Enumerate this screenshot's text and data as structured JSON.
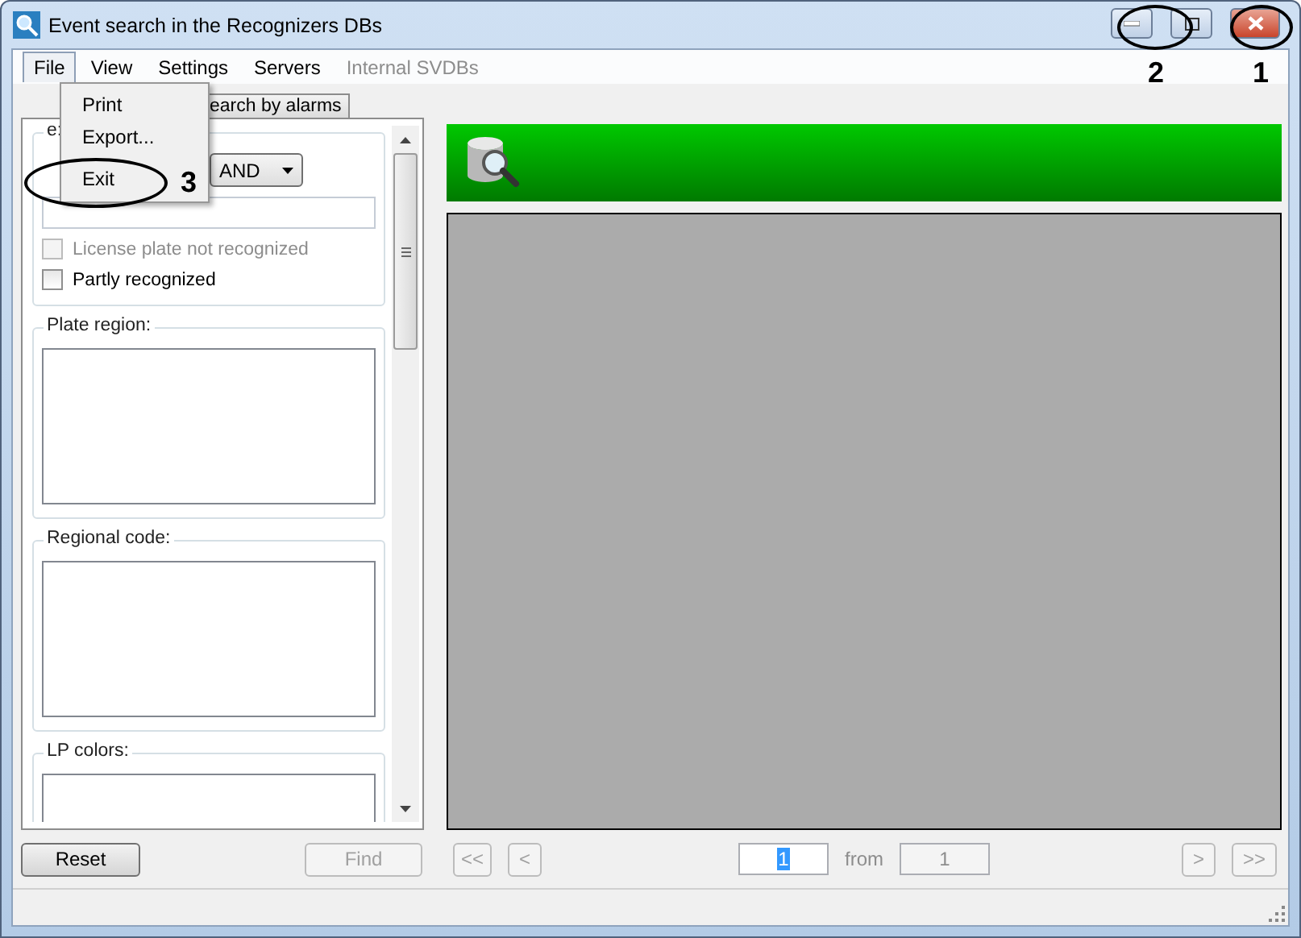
{
  "window": {
    "title": "Event search in the Recognizers DBs"
  },
  "menu": [
    {
      "label": "File",
      "selected": true,
      "disabled": false
    },
    {
      "label": "View",
      "selected": false,
      "disabled": false
    },
    {
      "label": "Settings",
      "selected": false,
      "disabled": false
    },
    {
      "label": "Servers",
      "selected": false,
      "disabled": false
    },
    {
      "label": "Internal SVDBs",
      "selected": false,
      "disabled": true
    }
  ],
  "file_menu": {
    "items": [
      {
        "label": "Print"
      },
      {
        "label": "Export..."
      },
      {
        "label": "Exit"
      }
    ]
  },
  "tabs": [
    {
      "label": "earch by alarms",
      "selected": false
    }
  ],
  "filter_group": {
    "title": "e:",
    "operator": "AND",
    "checkboxes": [
      {
        "label": "License plate not recognized",
        "checked": false,
        "disabled": true
      },
      {
        "label": "Partly recognized",
        "checked": false,
        "disabled": false
      }
    ]
  },
  "list_groups": [
    {
      "title": "Plate region:"
    },
    {
      "title": "Regional code:"
    },
    {
      "title": "LP colors:"
    }
  ],
  "buttons": [
    {
      "label": "Reset",
      "disabled": false
    },
    {
      "label": "Find",
      "disabled": true
    }
  ],
  "pager": {
    "first": "<<",
    "prev": "<",
    "page": "1",
    "from": "from",
    "total": "1",
    "next": ">",
    "last": ">>"
  },
  "annotations": [
    "1",
    "2",
    "3"
  ]
}
